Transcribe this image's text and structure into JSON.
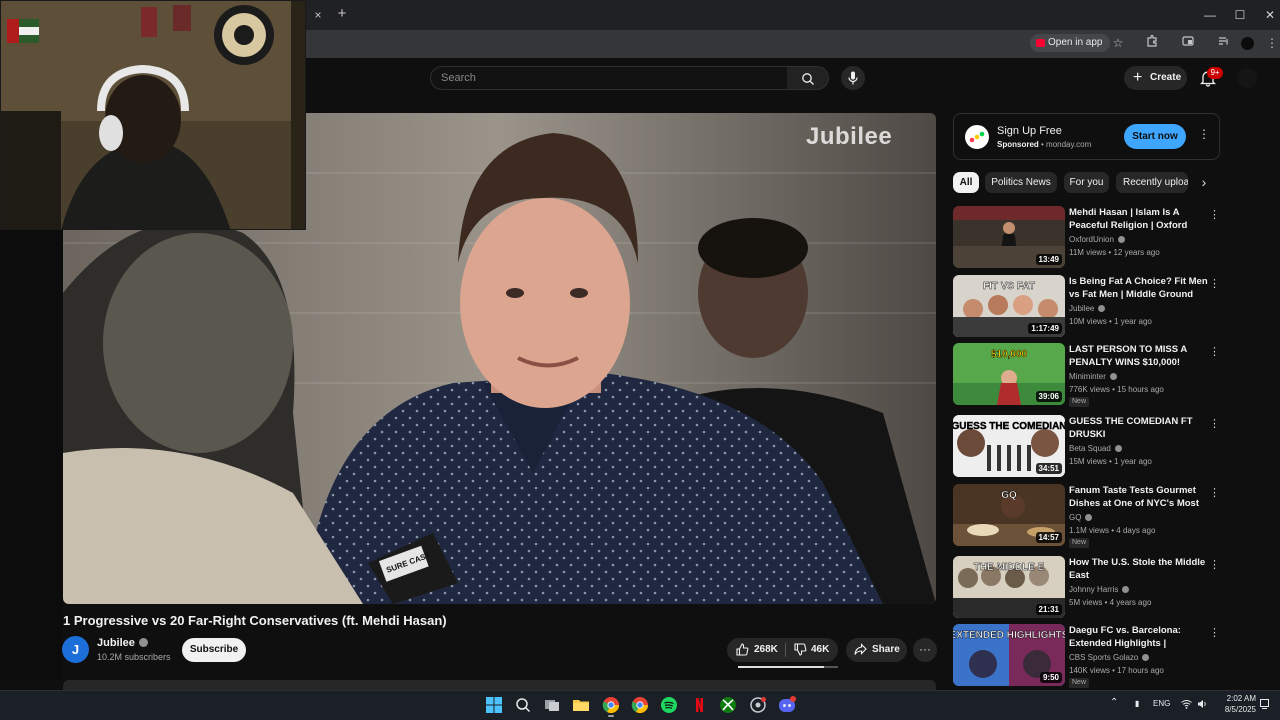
{
  "browser": {
    "tab_close": "×",
    "new_tab": "+",
    "open_in_app": "Open in app",
    "window_controls": {
      "minimize": "—",
      "maximize": "☐",
      "close": "✕"
    }
  },
  "masthead": {
    "search_placeholder": "Search",
    "create_label": "Create",
    "notification_count": "9+"
  },
  "video": {
    "watermark": "Jubilee",
    "mic_flag_text": "SURE CAST",
    "title": "1 Progressive vs 20 Far-Right Conservatives (ft. Mehdi Hasan)",
    "channel_initial": "J",
    "channel_name": "Jubilee",
    "subscribers": "10.2M subscribers",
    "subscribe_label": "Subscribe",
    "likes": "268K",
    "dislikes": "46K",
    "share_label": "Share",
    "more_label": "···",
    "like_ratio": 0.86
  },
  "ad": {
    "title": "Sign Up Free",
    "sponsored": "Sponsored",
    "domain": "monday.com",
    "cta": "Start now",
    "kebab": "⋮"
  },
  "chips": [
    "All",
    "Politics News",
    "For you",
    "Recently uploaded"
  ],
  "chips_next": "›",
  "recommendations": [
    {
      "title": "Mehdi Hasan | Islam Is A Peaceful Religion | Oxford Union",
      "channel": "OxfordUnion",
      "views": "11M views",
      "age": "12 years ago",
      "duration": "13:49",
      "badge": "",
      "thumb_text": ""
    },
    {
      "title": "Is Being Fat A Choice? Fit Men vs Fat Men | Middle Ground",
      "channel": "Jubilee",
      "views": "10M views",
      "age": "1 year ago",
      "duration": "1:17:49",
      "badge": "",
      "thumb_text": "FIT VS FAT"
    },
    {
      "title": "LAST PERSON TO MISS A PENALTY WINS $10,000!",
      "channel": "Miniminter",
      "views": "776K views",
      "age": "15 hours ago",
      "duration": "39:06",
      "badge": "New",
      "thumb_text": "$10,000"
    },
    {
      "title": "GUESS THE COMEDIAN FT DRUSKI",
      "channel": "Beta Squad",
      "views": "15M views",
      "age": "1 year ago",
      "duration": "34:51",
      "badge": "",
      "thumb_text": "GUESS THE COMEDIAN"
    },
    {
      "title": "Fanum Taste Tests Gourmet Dishes at One of NYC's Most ...",
      "channel": "GQ",
      "views": "1.1M views",
      "age": "4 days ago",
      "duration": "14:57",
      "badge": "New",
      "thumb_text": "GQ"
    },
    {
      "title": "How The U.S. Stole the Middle East",
      "channel": "Johnny Harris",
      "views": "5M views",
      "age": "4 years ago",
      "duration": "21:31",
      "badge": "",
      "thumb_text": "THE MIDDLE E"
    },
    {
      "title": "Daegu FC vs. Barcelona: Extended Highlights | Summer...",
      "channel": "CBS Sports Golazo",
      "views": "140K views",
      "age": "17 hours ago",
      "duration": "9:50",
      "badge": "New",
      "thumb_text": "EXTENDED HIGHLIGHTS"
    }
  ],
  "rec_kebab": "⋮",
  "meta_separator": " • ",
  "taskbar": {
    "tray_language": "ENG",
    "time": "2:02 AM",
    "date": "8/5/2025",
    "tray_chevron": "⌃"
  },
  "colors": {
    "background": "#0f0f0f",
    "accent_blue": "#3ea6ff",
    "youtube_red": "#ff0033",
    "chip_bg": "#272727"
  }
}
